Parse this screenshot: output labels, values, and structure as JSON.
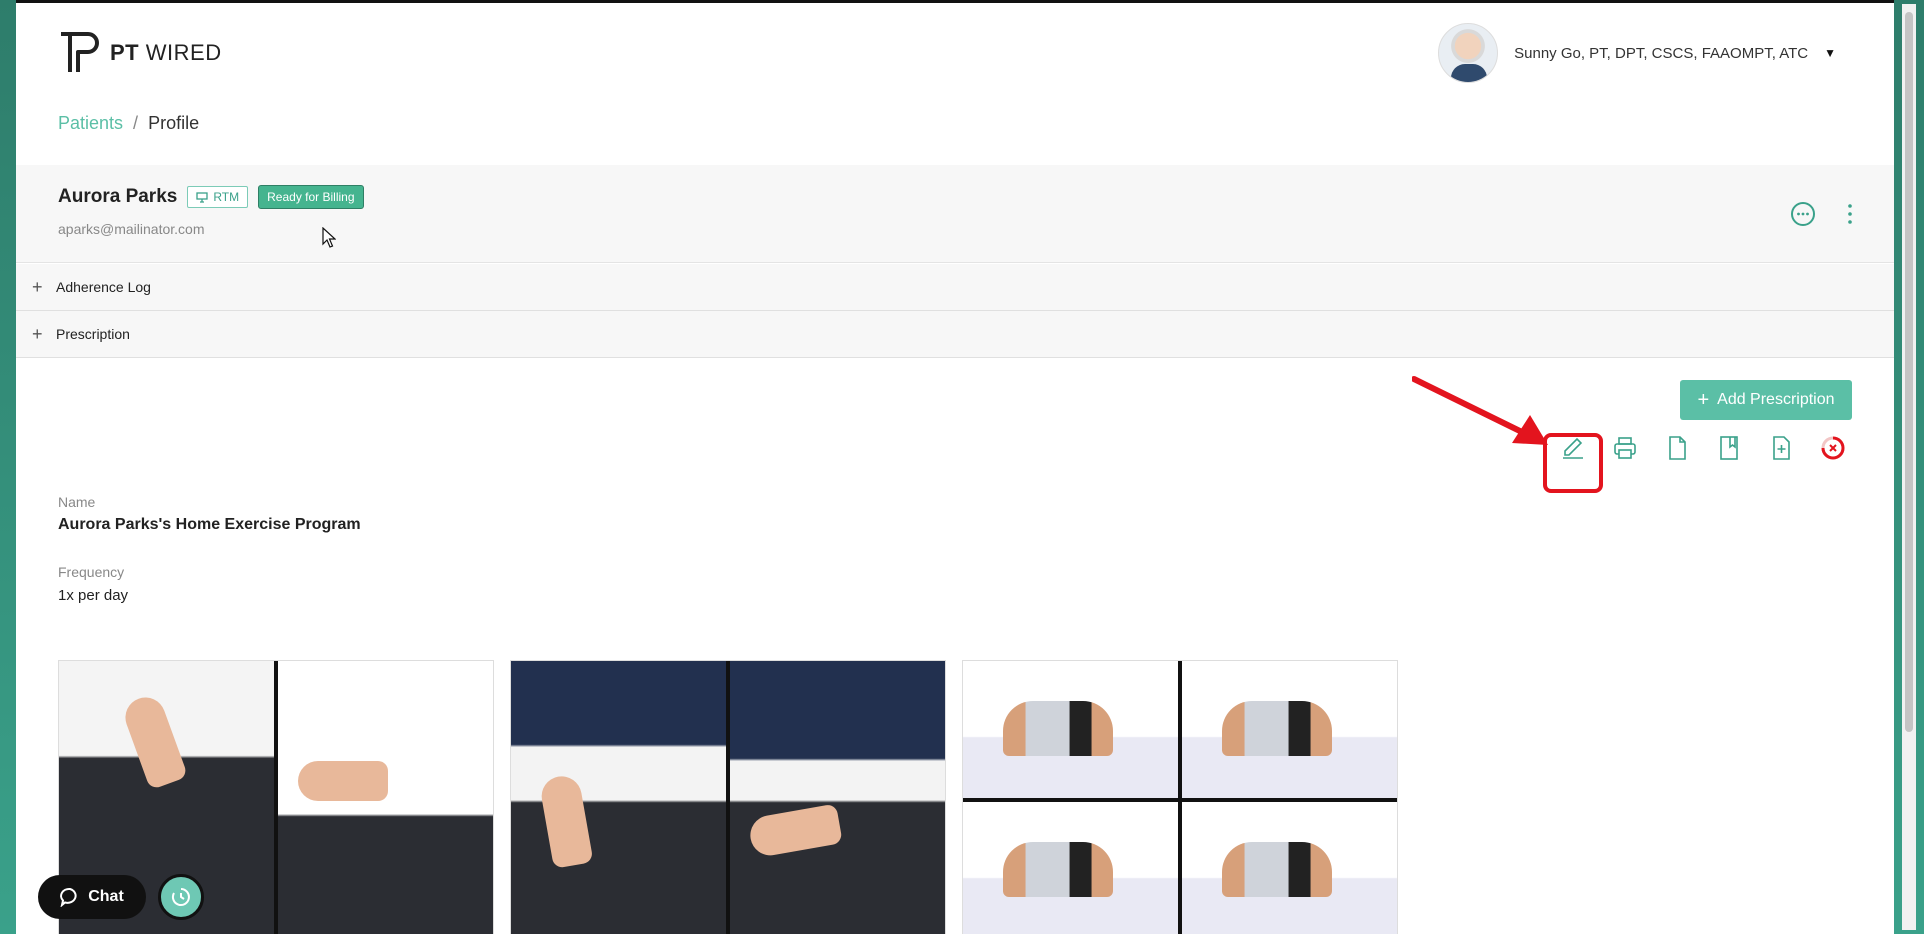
{
  "brand": {
    "bold": "PT",
    "light": "WIRED"
  },
  "user": {
    "name": "Sunny Go, PT, DPT, CSCS, FAAOMPT, ATC"
  },
  "breadcrumb": {
    "link": "Patients",
    "separator": "/",
    "current": "Profile"
  },
  "patient": {
    "name": "Aurora Parks",
    "rtm_badge": "RTM",
    "status_badge": "Ready for Billing",
    "email": "aparks@mailinator.com"
  },
  "accordions": [
    {
      "label": "Adherence Log",
      "expand_icon": "+"
    },
    {
      "label": "Prescription",
      "expand_icon": "+"
    }
  ],
  "prescription": {
    "add_button": "Add Prescription",
    "add_plus": "+",
    "name_label": "Name",
    "name_value": "Aurora Parks's Home Exercise Program",
    "frequency_label": "Frequency",
    "frequency_value": "1x per day",
    "toolbar_icons": [
      "edit-icon",
      "print-icon",
      "document-icon",
      "bookmark-icon",
      "add-file-icon",
      "delete-progress-icon"
    ]
  },
  "chat": {
    "label": "Chat"
  },
  "colors": {
    "accent": "#5bbfa6",
    "billing": "#45b48f",
    "highlight": "#e3141e"
  }
}
